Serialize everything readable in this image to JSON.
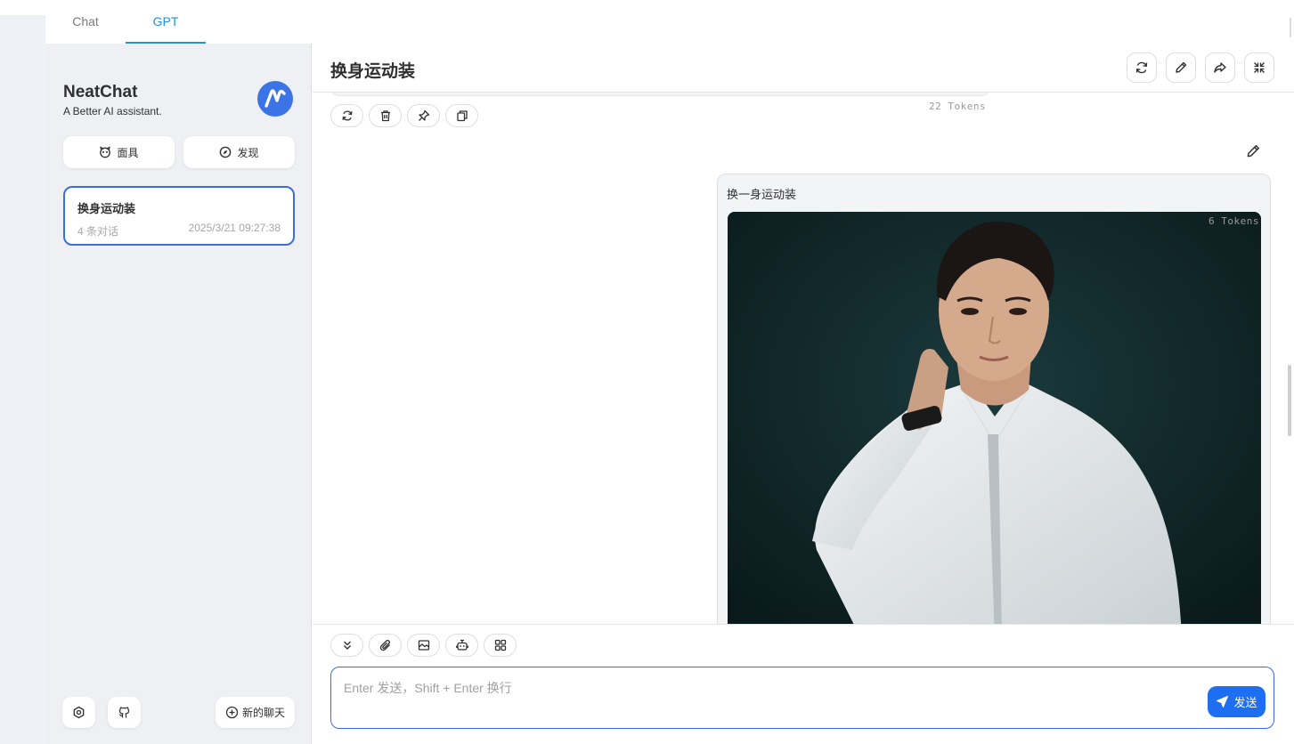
{
  "tabs": [
    {
      "label": "Chat",
      "active": false
    },
    {
      "label": "GPT",
      "active": true
    }
  ],
  "sidebar": {
    "brand_title": "NeatChat",
    "brand_subtitle": "A Better AI assistant.",
    "logo_icon": "neatchat-logo-icon",
    "mask_button": {
      "label": "面具",
      "icon": "mask-icon"
    },
    "discover_button": {
      "label": "发现",
      "icon": "compass-icon"
    },
    "chat_list": [
      {
        "title": "换身运动装",
        "count": "4 条对话",
        "date": "2025/3/21 09:27:38",
        "selected": true
      }
    ],
    "settings_icon": "settings-icon",
    "github_icon": "github-icon",
    "new_chat_label": "新的聊天"
  },
  "main": {
    "title": "换身运动装",
    "header_buttons": [
      "refresh-icon",
      "edit-icon",
      "share-icon",
      "collapse-icon"
    ],
    "prev_message": {
      "tokens": "22 Tokens",
      "actions": [
        "retry-icon",
        "delete-icon",
        "pin-icon",
        "copy-icon"
      ]
    },
    "user_message": {
      "text": "换一身运动装",
      "tokens": "6 Tokens",
      "image_description_icon": "photo-icon"
    },
    "tools": [
      "scroll-down-icon",
      "attach-icon",
      "image-icon",
      "robot-icon",
      "apps-icon"
    ],
    "input": {
      "placeholder": "Enter 发送，Shift + Enter 换行",
      "send_label": "发送"
    }
  },
  "colors": {
    "accent": "#3a6fd8",
    "send_button": "#1d6ef0",
    "tab_active": "#2a8fd6",
    "sidebar_bg": "#eef0f4"
  }
}
